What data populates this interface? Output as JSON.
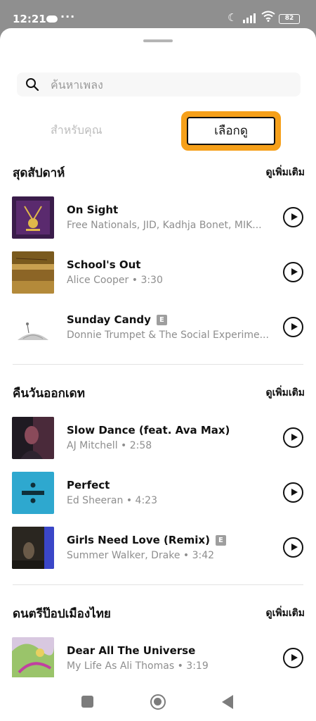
{
  "status_bar": {
    "time": "12:21",
    "dots": "···",
    "battery": "82",
    "icons": [
      "game-controller-icon",
      "moon-icon",
      "signal-icon",
      "wifi-icon",
      "battery-icon"
    ]
  },
  "search": {
    "placeholder": "ค้นหาเพลง",
    "value": ""
  },
  "tabs": [
    {
      "label": "สำหรับคุณ",
      "active": false
    },
    {
      "label": "เลือกดู",
      "active": true
    }
  ],
  "sections": [
    {
      "title": "สุดสัปดาห์",
      "see_more": "ดูเพิ่มเติม",
      "tracks": [
        {
          "title": "On Sight",
          "explicit": false,
          "subtitle": "Free Nationals, JID, Kadhja Bonet, MIK..."
        },
        {
          "title": "School's Out",
          "explicit": false,
          "subtitle": "Alice Cooper • 3:30"
        },
        {
          "title": "Sunday Candy",
          "explicit": true,
          "subtitle": "Donnie Trumpet & The Social Experime..."
        }
      ]
    },
    {
      "title": "คืนวันออกเดท",
      "see_more": "ดูเพิ่มเติม",
      "tracks": [
        {
          "title": "Slow Dance (feat. Ava Max)",
          "explicit": false,
          "subtitle": "AJ Mitchell • 2:58"
        },
        {
          "title": "Perfect",
          "explicit": false,
          "subtitle": "Ed Sheeran • 4:23"
        },
        {
          "title": "Girls Need Love (Remix)",
          "explicit": true,
          "subtitle": "Summer Walker, Drake • 3:42"
        }
      ]
    },
    {
      "title": "ดนตรีป๊อปเมืองไทย",
      "see_more": "ดูเพิ่มเติม",
      "tracks": [
        {
          "title": "Dear All The Universe",
          "explicit": false,
          "subtitle": "My Life As Ali Thomas • 3:19"
        }
      ]
    }
  ],
  "explicit_badge": "E",
  "colors": {
    "accent_highlight": "#f6a01a",
    "status_bar_bg": "#8f8f8f",
    "subtitle_text": "#8e8e8e"
  }
}
